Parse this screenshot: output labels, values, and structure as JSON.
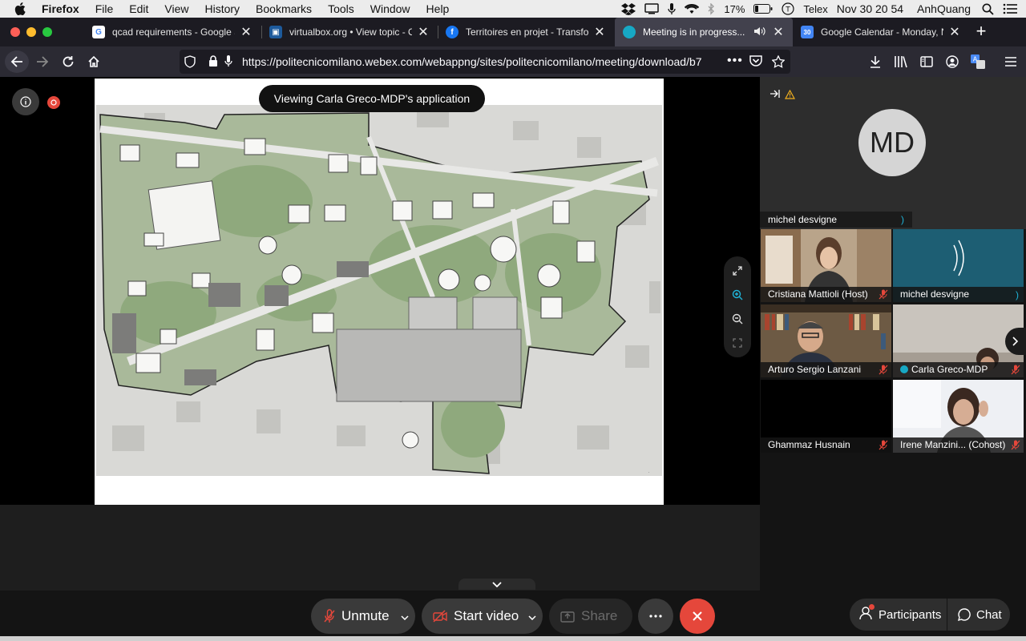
{
  "menubar": {
    "app_name": "Firefox",
    "items": [
      "File",
      "Edit",
      "View",
      "History",
      "Bookmarks",
      "Tools",
      "Window",
      "Help"
    ],
    "battery": "17%",
    "input_source": "Telex",
    "clock": "Nov 30  20 54",
    "user": "AnhQuang"
  },
  "tabs": [
    {
      "title": "qcad requirements - Google Se",
      "icon": "google-icon",
      "color": "#ffffff"
    },
    {
      "title": "virtualbox.org • View topic - O",
      "icon": "virtualbox-icon",
      "color": "#1d5a9c"
    },
    {
      "title": "Territoires en projet - Transfor",
      "icon": "facebook-icon",
      "color": "#1877f2"
    },
    {
      "title": "Meeting is in progress...",
      "icon": "webex-icon",
      "color": "#17a8c4"
    },
    {
      "title": "Google Calendar - Monday, No",
      "icon": "google-calendar-icon",
      "color": "#4285f4"
    }
  ],
  "navbar": {
    "url": "https://politecnicomilano.webex.com/webappng/sites/politecnicomilano/meeting/download/b7"
  },
  "meeting": {
    "viewing_label": "Viewing Carla Greco-MDP's application",
    "active_speaker_initials": "MD",
    "active_speaker_name": "michel desvigne",
    "participants": [
      {
        "name": "Cristiana Mattioli (Host)",
        "muted": true
      },
      {
        "name": "michel desvigne",
        "muted": false
      },
      {
        "name": "Arturo Sergio Lanzani",
        "muted": true
      },
      {
        "name": "Carla Greco-MDP",
        "muted": true
      },
      {
        "name": "Ghammaz Husnain",
        "muted": true
      },
      {
        "name": "Irene Manzini... (Cohost)",
        "muted": true
      }
    ]
  },
  "controls": {
    "unmute": "Unmute",
    "start_video": "Start video",
    "share": "Share",
    "participants": "Participants",
    "chat": "Chat"
  },
  "colors": {
    "end_call": "#e5473b",
    "muted_icon": "#e5473b",
    "urlbar_bg": "#1c1b22",
    "tab_active": "#42414d"
  }
}
